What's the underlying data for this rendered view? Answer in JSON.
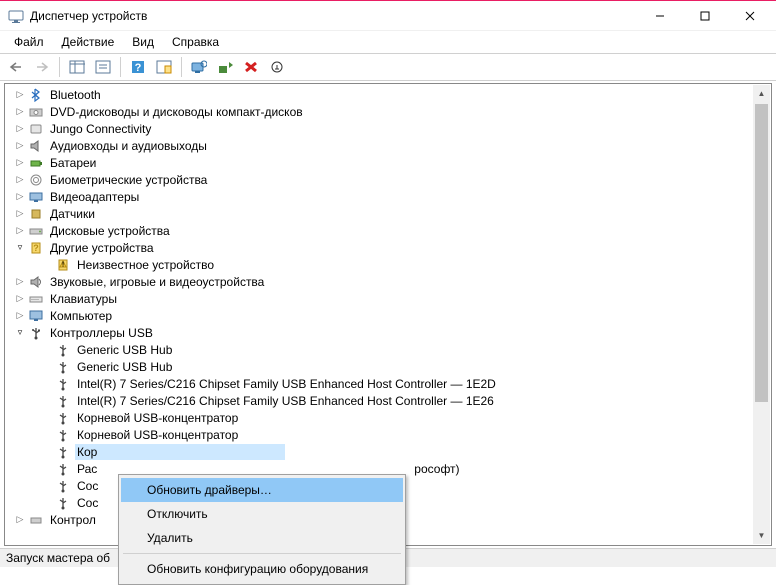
{
  "window": {
    "title": "Диспетчер устройств"
  },
  "menu": {
    "file": "Файл",
    "action": "Действие",
    "view": "Вид",
    "help": "Справка"
  },
  "status": "Запуск мастера об",
  "categories": [
    {
      "label": "Bluetooth",
      "expanded": false
    },
    {
      "label": "DVD-дисководы и дисководы компакт-дисков",
      "expanded": false
    },
    {
      "label": "Jungo Connectivity",
      "expanded": false
    },
    {
      "label": "Аудиовходы и аудиовыходы",
      "expanded": false
    },
    {
      "label": "Батареи",
      "expanded": false
    },
    {
      "label": "Биометрические устройства",
      "expanded": false
    },
    {
      "label": "Видеоадаптеры",
      "expanded": false
    },
    {
      "label": "Датчики",
      "expanded": false
    },
    {
      "label": "Дисковые устройства",
      "expanded": false
    },
    {
      "label": "Другие устройства",
      "expanded": true
    },
    {
      "label": "Звуковые, игровые и видеоустройства",
      "expanded": false
    },
    {
      "label": "Клавиатуры",
      "expanded": false
    },
    {
      "label": "Компьютер",
      "expanded": false
    },
    {
      "label": "Контроллеры USB",
      "expanded": true
    }
  ],
  "other_devices": {
    "child": "Неизвестное устройство"
  },
  "usb": {
    "items": [
      "Generic USB Hub",
      "Generic USB Hub",
      "Intel(R) 7 Series/C216 Chipset Family USB Enhanced Host Controller — 1E2D",
      "Intel(R) 7 Series/C216 Chipset Family USB Enhanced Host Controller — 1E26",
      "Корневой USB-концентратор",
      "Корневой USB-концентратор",
      "Кор",
      "Рас",
      "Сос",
      "Сос"
    ],
    "suffix_ras": "рософт)",
    "last_partial": "Контрол"
  },
  "context_menu": {
    "update": "Обновить драйверы…",
    "disable": "Отключить",
    "delete": "Удалить",
    "refresh": "Обновить конфигурацию оборудования"
  }
}
